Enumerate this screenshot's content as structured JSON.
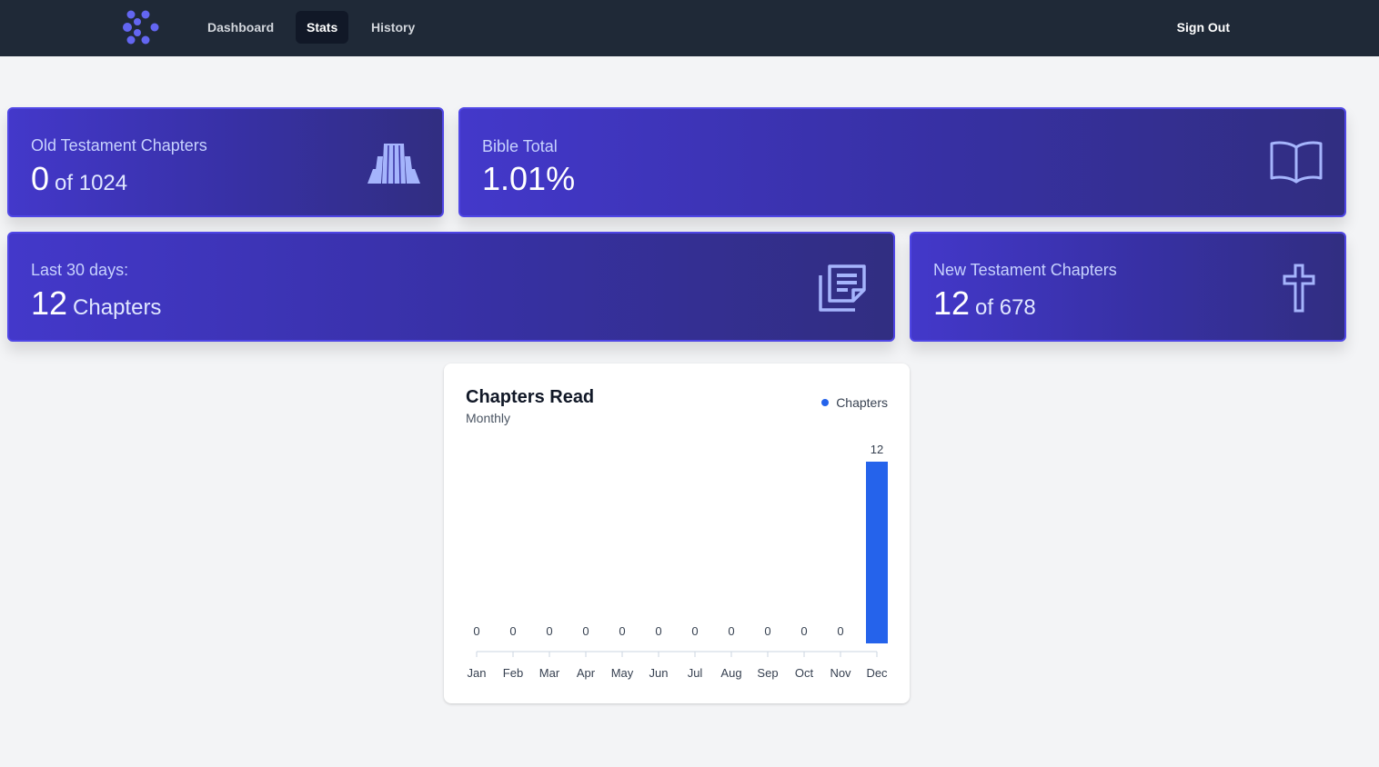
{
  "nav": {
    "links": [
      "Dashboard",
      "Stats",
      "History"
    ],
    "active": "Stats",
    "sign_out": "Sign Out"
  },
  "cards": {
    "old_testament": {
      "label": "Old Testament Chapters",
      "value": "0",
      "suffix": "of 1024",
      "icon": "columns-icon"
    },
    "bible_total": {
      "label": "Bible Total",
      "value": "1.01%",
      "icon": "open-book-icon"
    },
    "last_30": {
      "label": "Last 30 days:",
      "value": "12",
      "suffix": "Chapters",
      "icon": "notes-icon"
    },
    "new_testament": {
      "label": "New Testament Chapters",
      "value": "12",
      "suffix": "of 678",
      "icon": "cross-icon"
    }
  },
  "colors": {
    "nav_bg": "#1f2937",
    "card_accent": "#4338ca",
    "bar": "#2563eb"
  },
  "chart": {
    "title": "Chapters Read",
    "subtitle": "Monthly",
    "legend": "Chapters"
  },
  "chart_data": {
    "type": "bar",
    "title": "Chapters Read",
    "subtitle": "Monthly",
    "categories": [
      "Jan",
      "Feb",
      "Mar",
      "Apr",
      "May",
      "Jun",
      "Jul",
      "Aug",
      "Sep",
      "Oct",
      "Nov",
      "Dec"
    ],
    "series": [
      {
        "name": "Chapters",
        "values": [
          0,
          0,
          0,
          0,
          0,
          0,
          0,
          0,
          0,
          0,
          0,
          12
        ]
      }
    ],
    "ylim": [
      0,
      12
    ],
    "grid": false,
    "legend": "top-right"
  }
}
